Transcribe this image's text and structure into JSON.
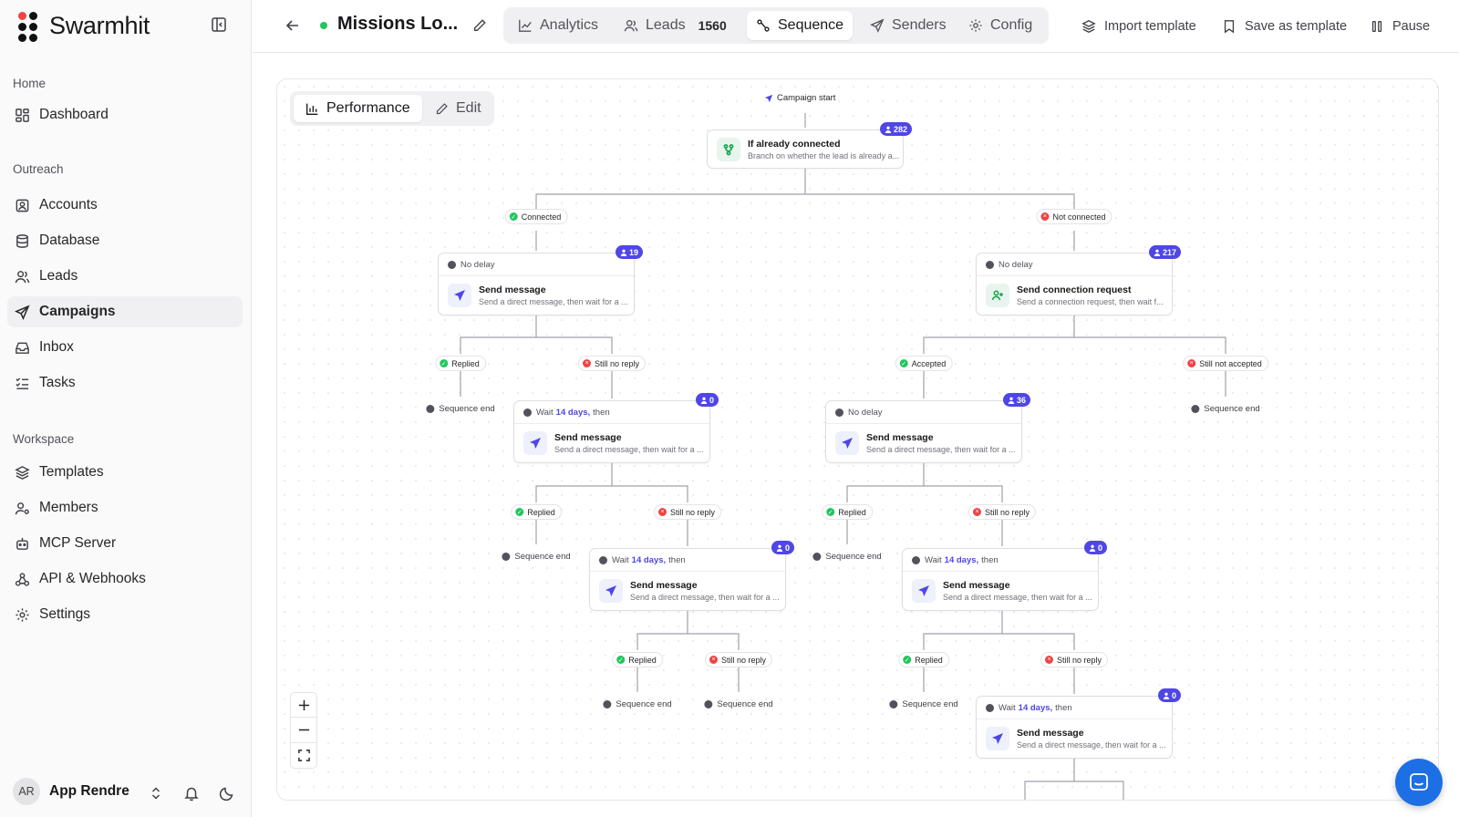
{
  "sidebar": {
    "brand": "Swarmhit",
    "sections": [
      {
        "label": "Home",
        "items": [
          {
            "label": "Dashboard",
            "icon": "dashboard-icon"
          }
        ]
      },
      {
        "label": "Outreach",
        "items": [
          {
            "label": "Accounts",
            "icon": "accounts-icon"
          },
          {
            "label": "Database",
            "icon": "database-icon"
          },
          {
            "label": "Leads",
            "icon": "leads-icon"
          },
          {
            "label": "Campaigns",
            "icon": "campaigns-icon",
            "active": true
          },
          {
            "label": "Inbox",
            "icon": "inbox-icon"
          },
          {
            "label": "Tasks",
            "icon": "tasks-icon"
          }
        ]
      },
      {
        "label": "Workspace",
        "items": [
          {
            "label": "Templates",
            "icon": "templates-icon"
          },
          {
            "label": "Members",
            "icon": "members-icon"
          },
          {
            "label": "MCP Server",
            "icon": "mcp-server-icon"
          },
          {
            "label": "API & Webhooks",
            "icon": "webhooks-icon"
          },
          {
            "label": "Settings",
            "icon": "settings-icon"
          }
        ]
      }
    ],
    "user": {
      "initials": "AR",
      "name": "App Rendre"
    }
  },
  "header": {
    "campaign_title": "Missions Lo...",
    "tabs": [
      {
        "label": "Analytics",
        "icon": "analytics-icon"
      },
      {
        "label": "Leads",
        "icon": "leads-icon",
        "count": "1560"
      },
      {
        "label": "Sequence",
        "icon": "sequence-icon",
        "active": true
      },
      {
        "label": "Senders",
        "icon": "senders-icon"
      },
      {
        "label": "Config",
        "icon": "config-icon"
      }
    ],
    "actions": {
      "import": "Import template",
      "save": "Save as template",
      "pause": "Pause"
    }
  },
  "canvas": {
    "modes": {
      "performance": "Performance",
      "edit": "Edit",
      "active": "performance"
    },
    "start_label": "Campaign start",
    "root": {
      "title": "If already connected",
      "desc": "Branch on whether the lead is already a...",
      "count": "282"
    },
    "nodes": [
      {
        "id": "c1",
        "delay": "No delay",
        "title": "Send message",
        "desc": "Send a direct message, then wait for a ...",
        "count": "19",
        "icon": "send-icon"
      },
      {
        "id": "n1",
        "delay": "No delay",
        "title": "Send connection request",
        "desc": "Send a connection request, then wait f...",
        "count": "217",
        "icon": "user-plus-icon"
      },
      {
        "id": "c2",
        "delay_pre": "Wait",
        "delay_days": "14 days,",
        "delay_post": "then",
        "title": "Send message",
        "desc": "Send a direct message, then wait for a ...",
        "count": "0",
        "icon": "send-icon"
      },
      {
        "id": "n2",
        "delay": "No delay",
        "title": "Send message",
        "desc": "Send a direct message, then wait for a ...",
        "count": "36",
        "icon": "send-icon"
      },
      {
        "id": "c3",
        "delay_pre": "Wait",
        "delay_days": "14 days,",
        "delay_post": "then",
        "title": "Send message",
        "desc": "Send a direct message, then wait for a ...",
        "count": "0",
        "icon": "send-icon"
      },
      {
        "id": "n3",
        "delay_pre": "Wait",
        "delay_days": "14 days,",
        "delay_post": "then",
        "title": "Send message",
        "desc": "Send a direct message, then wait for a ...",
        "count": "0",
        "icon": "send-icon"
      },
      {
        "id": "n4",
        "delay_pre": "Wait",
        "delay_days": "14 days,",
        "delay_post": "then",
        "title": "Send message",
        "desc": "Send a direct message, then wait for a ...",
        "count": "0",
        "icon": "send-icon"
      }
    ],
    "conditions": {
      "connected": "Connected",
      "not_connected": "Not connected",
      "replied": "Replied",
      "still_no_reply": "Still no reply",
      "accepted": "Accepted",
      "still_not_accepted": "Still not accepted"
    },
    "sequence_end": "Sequence end"
  },
  "colors": {
    "accent": "#4f46e5",
    "positive": "#22c55e",
    "negative": "#ef4444",
    "chat": "#1d6fe6"
  }
}
